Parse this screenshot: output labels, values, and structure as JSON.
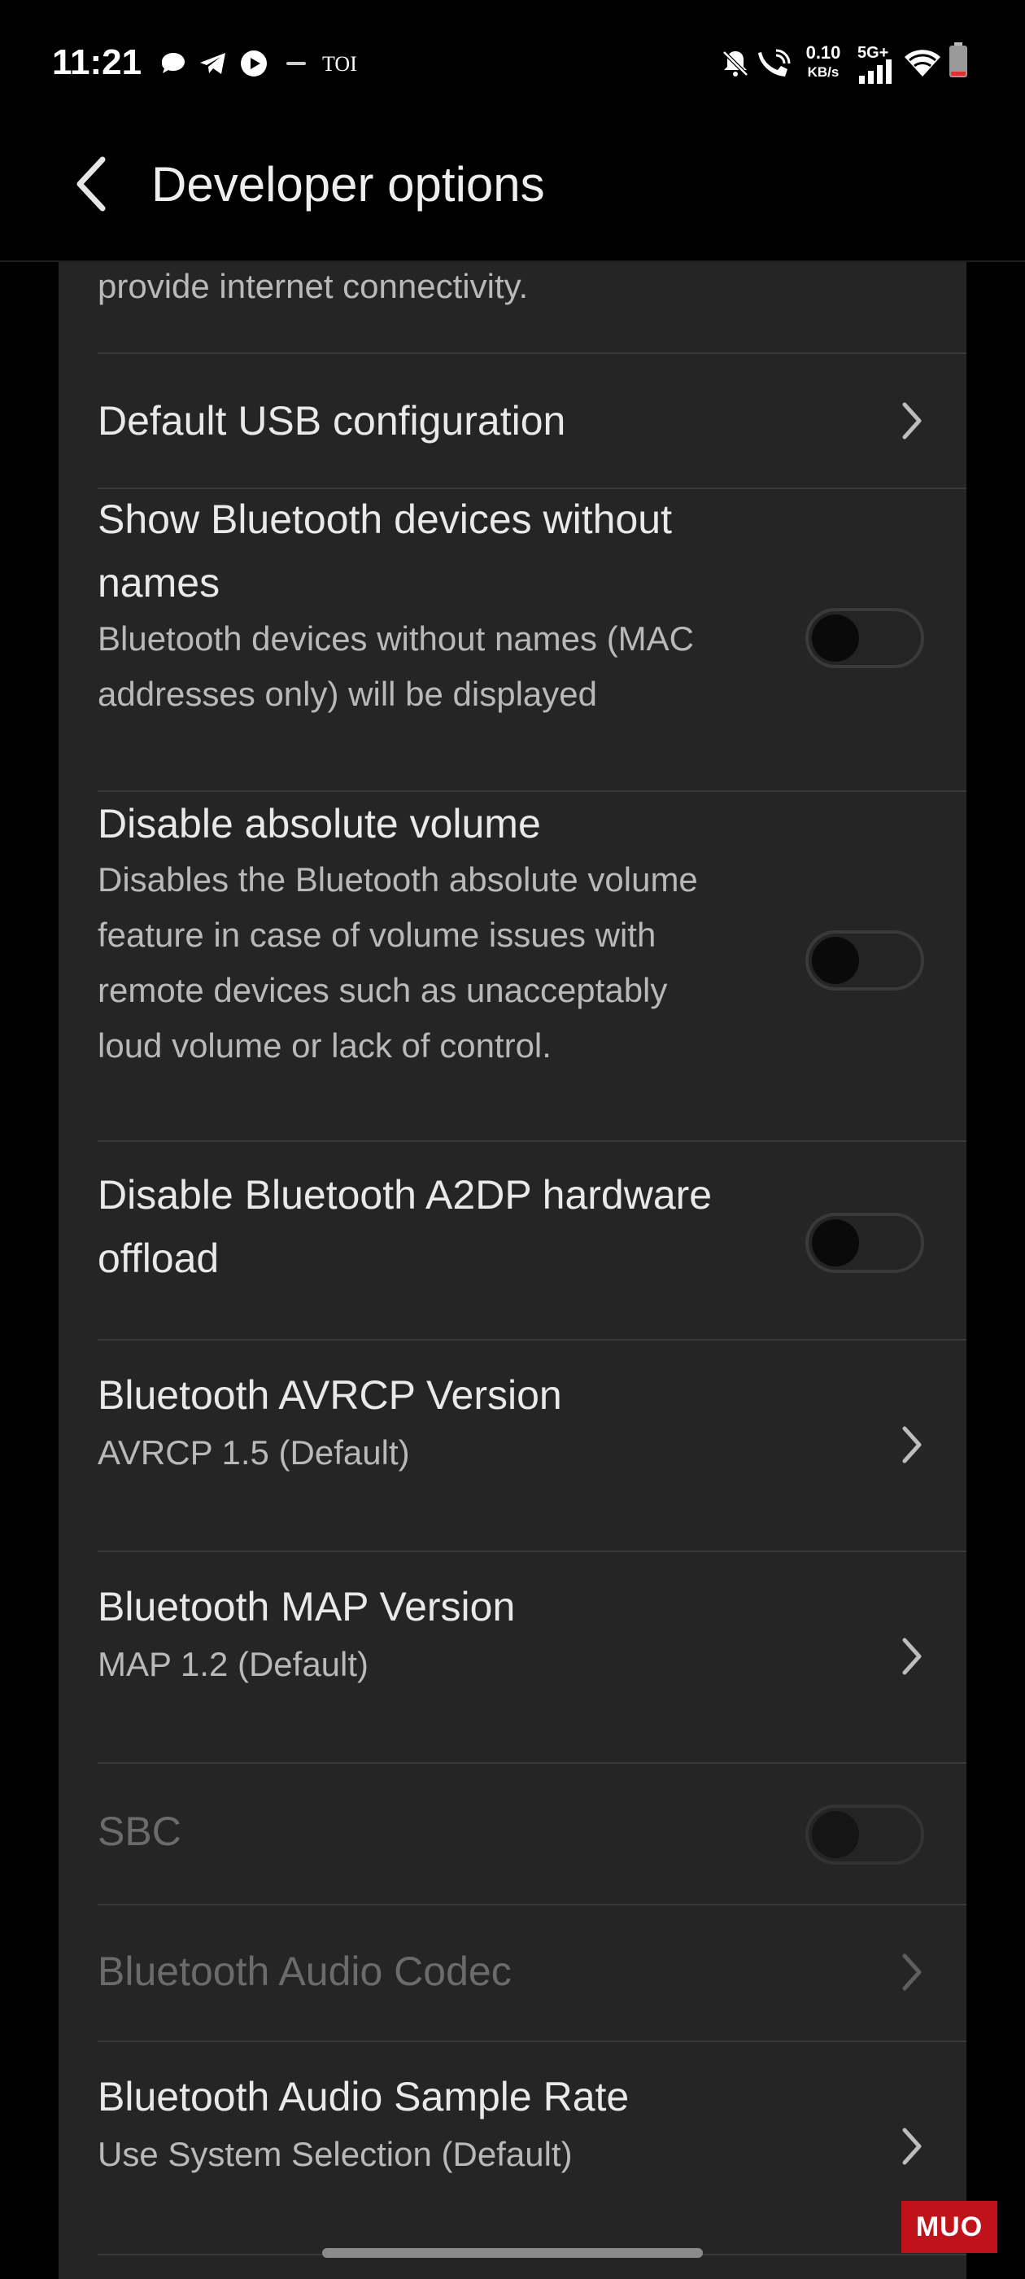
{
  "status_bar": {
    "time": "11:21",
    "brand_text": "TOI",
    "net_speed_value": "0.10",
    "net_speed_unit": "KB/s",
    "network_type": "5G+",
    "notification_icons": [
      "chat-bubble-icon",
      "telegram-icon",
      "youtube-icon",
      "app-icon"
    ],
    "system_icons": [
      "bell-off-icon",
      "wifi-calling-icon",
      "signal-icon",
      "wifi-icon",
      "battery-icon"
    ]
  },
  "header": {
    "title": "Developer options",
    "back_icon": "back-arrow-icon"
  },
  "settings": {
    "partial_item": {
      "subtitle": "provide internet connectivity."
    },
    "items": [
      {
        "title": "Default USB configuration",
        "control": "chevron"
      },
      {
        "title_line1": "Show Bluetooth devices without",
        "title_line2": "names",
        "sub_line1": "Bluetooth devices without names (MAC",
        "sub_line2": "addresses only) will be displayed",
        "control": "toggle",
        "checked": false
      },
      {
        "title": "Disable absolute volume",
        "sub_line1": "Disables the Bluetooth absolute volume",
        "sub_line2": "feature in case of volume issues with",
        "sub_line3": "remote devices such as unacceptably",
        "sub_line4": "loud volume or lack of control.",
        "control": "toggle",
        "checked": false
      },
      {
        "title_line1": "Disable Bluetooth A2DP hardware",
        "title_line2": "offload",
        "control": "toggle",
        "checked": false
      },
      {
        "title": "Bluetooth AVRCP Version",
        "subtitle": "AVRCP 1.5 (Default)",
        "control": "chevron"
      },
      {
        "title": "Bluetooth MAP Version",
        "subtitle": "MAP 1.2 (Default)",
        "control": "chevron"
      },
      {
        "title": "SBC",
        "control": "toggle",
        "checked": false,
        "disabled": true
      },
      {
        "title": "Bluetooth Audio Codec",
        "control": "chevron",
        "disabled": true
      },
      {
        "title": "Bluetooth Audio Sample Rate",
        "subtitle": "Use System Selection (Default)",
        "control": "chevron"
      }
    ]
  },
  "watermark": "MUO",
  "colors": {
    "background": "#000000",
    "card": "#252525",
    "text": "#e9e9e9",
    "secondary": "#b9b9b9",
    "disabled": "#6b6b6b"
  }
}
